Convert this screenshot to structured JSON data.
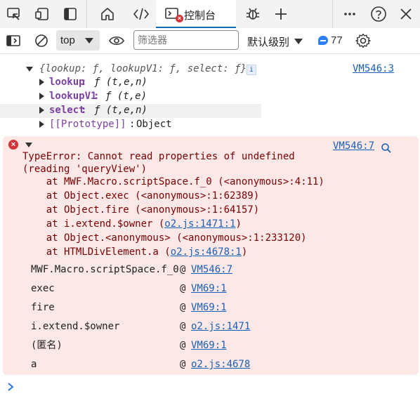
{
  "tabs": {
    "console_label": "控制台"
  },
  "toolbar": {
    "context_value": "top",
    "filter_placeholder": "筛选器",
    "level_label": "默认级别",
    "message_count": "77"
  },
  "object_log": {
    "summary": "{lookup: ƒ, lookupV1: ƒ, select: ƒ}",
    "info_badge": "i",
    "source": "VM546:3",
    "props": [
      {
        "key": "lookup",
        "value": "ƒ (t,e,n)"
      },
      {
        "key": "lookupV1",
        "value": "ƒ (t,e)"
      },
      {
        "key": "select",
        "value": "ƒ (t,e,n)"
      },
      {
        "key": "[[Prototype]]",
        "value": "Object"
      }
    ]
  },
  "error_log": {
    "source": "VM546:7",
    "message_lines": [
      "TypeError: Cannot read properties of undefined",
      "(reading 'queryView')"
    ],
    "stack": [
      {
        "text": "    at MWF.Macro.scriptSpace.f_0 (<anonymous>:4:11)",
        "link": ""
      },
      {
        "text": "    at Object.exec (<anonymous>:1:62389)",
        "link": ""
      },
      {
        "text": "    at Object.fire (<anonymous>:1:64157)",
        "link": ""
      },
      {
        "text": "    at i.extend.$owner (",
        "link": "o2.js:1471:1",
        "after": ")"
      },
      {
        "text": "    at Object.<anonymous> (<anonymous>:1:233120)",
        "link": ""
      },
      {
        "text": "    at HTMLDivElement.a (",
        "link": "o2.js:4678:1",
        "after": ")"
      }
    ],
    "frames": [
      {
        "name": "MWF.Macro.scriptSpace.f_0",
        "at": "@",
        "link": "VM546:7"
      },
      {
        "name": "exec",
        "at": "@",
        "link": "VM69:1"
      },
      {
        "name": "fire",
        "at": "@",
        "link": "VM69:1"
      },
      {
        "name": "i.extend.$owner",
        "at": "@",
        "link": "o2.js:1471"
      },
      {
        "name": "(匿名)",
        "at": "@",
        "link": "VM69:1"
      },
      {
        "name": "a",
        "at": "@",
        "link": "o2.js:4678"
      }
    ]
  },
  "colors": {
    "accent": "#0f6cbd",
    "error_bg": "#fde8e8",
    "error_icon": "#d13438",
    "link": "#1a5fb4"
  }
}
